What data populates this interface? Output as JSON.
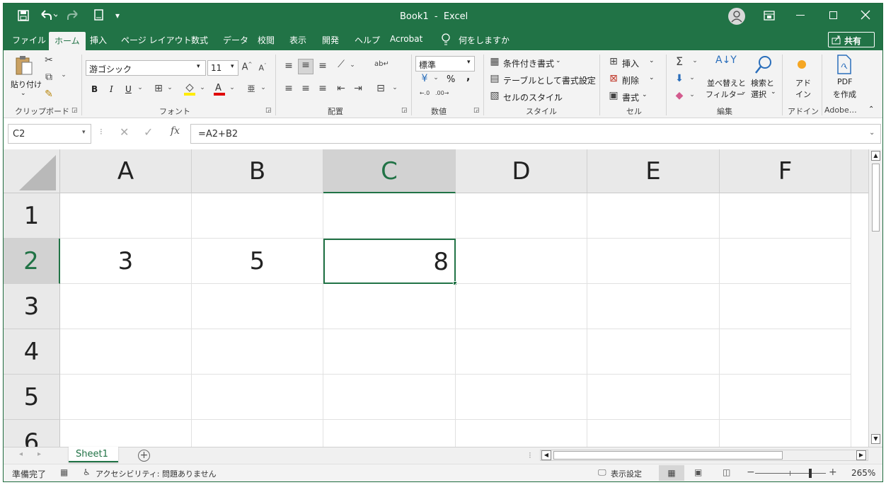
{
  "titlebar": {
    "title": "Book1  -  Excel",
    "save_icon": "save-icon",
    "undo_icon": "undo-icon",
    "redo_icon": "redo-icon",
    "qat_more": "▾"
  },
  "tabs": [
    "ファイル",
    "ホーム",
    "挿入",
    "ページ レイアウト",
    "数式",
    "データ",
    "校閲",
    "表示",
    "開発",
    "ヘルプ",
    "Acrobat"
  ],
  "tell_me": "何をしますか",
  "share_label": "共有",
  "ribbon": {
    "clipboard": {
      "paste_label": "貼り付け",
      "group_label": "クリップボード"
    },
    "font": {
      "font_name": "游ゴシック",
      "font_size": "11",
      "group_label": "フォント",
      "bold": "B",
      "italic": "I",
      "underline": "U"
    },
    "alignment": {
      "group_label": "配置"
    },
    "number": {
      "format": "標準",
      "percent": "%",
      "comma": ",",
      "group_label": "数値"
    },
    "styles": {
      "cond_format": "条件付き書式",
      "table_format": "テーブルとして書式設定",
      "cell_styles": "セルのスタイル",
      "group_label": "スタイル"
    },
    "cells": {
      "insert": "挿入",
      "delete": "削除",
      "format": "書式",
      "group_label": "セル"
    },
    "editing": {
      "sort_filter_line1": "並べ替えと",
      "sort_filter_line2": "フィルター",
      "find_line1": "検索と",
      "find_line2": "選択",
      "group_label": "編集"
    },
    "addins": {
      "line1": "アド",
      "line2": "イン",
      "group_label": "アドイン"
    },
    "adobe": {
      "line1": "PDF",
      "line2": "を作成",
      "group_label": "Adobe…"
    }
  },
  "formula_bar": {
    "name_box": "C2",
    "formula": "=A2+B2",
    "fx": "fx"
  },
  "columns": [
    "A",
    "B",
    "C",
    "D",
    "E",
    "F"
  ],
  "rows": [
    "1",
    "2",
    "3",
    "4",
    "5",
    "6"
  ],
  "cells": {
    "A2": "3",
    "B2": "5",
    "C2": "8"
  },
  "selected_cell": "C2",
  "sheet_tabs": [
    "Sheet1"
  ],
  "status": {
    "ready": "準備完了",
    "accessibility": "アクセシビリティ: 問題ありません",
    "display_settings": "表示設定",
    "zoom": "265%"
  },
  "colors": {
    "accent": "#217346"
  }
}
